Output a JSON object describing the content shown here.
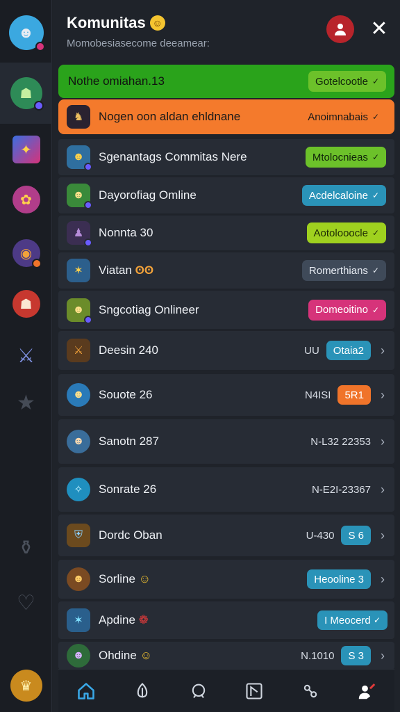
{
  "header": {
    "title": "Komunitas",
    "subtitle": "Momobesiasecome deeamear:"
  },
  "banners": [
    {
      "label": "Nothe omiahan.13",
      "action": "Gotelcootle"
    },
    {
      "label": "Nogen oon aldan ehldnane",
      "action": "Anoimnabais"
    }
  ],
  "rows": [
    {
      "name": "Sgenantags Commitas Nere",
      "status": "Mtolocnieas",
      "status_color": "#6cc12a"
    },
    {
      "name": "Dayorofiag Omline",
      "status": "Acdelcaloine",
      "status_color": "#2a93b8"
    },
    {
      "name": "Nonnta 30",
      "status": "Aotolooocle",
      "status_color": "#9fd11f"
    },
    {
      "name": "Viatan",
      "status": "Romerthians",
      "status_color": "#3f4a59"
    },
    {
      "name": "Sngcotiag Onlineer",
      "status": "Domeoitino",
      "status_color": "#d6337a"
    }
  ],
  "list": [
    {
      "name": "Deesin 240",
      "code": "UU",
      "badge": "Otaia2",
      "badge_color": "#2a93b8"
    },
    {
      "name": "Souote 26",
      "code": "N4ISI",
      "badge": "5R1",
      "badge_color": "#f0742a"
    },
    {
      "name": "Sanotn 287",
      "code": "N-L32 22353",
      "badge": "",
      "badge_color": ""
    },
    {
      "name": "Sonrate 26",
      "code": "N-E2I-23367",
      "badge": "",
      "badge_color": ""
    },
    {
      "name": "Dordc Oban",
      "code": "U-430",
      "badge": "S 6",
      "badge_color": "#2a93b8"
    },
    {
      "name": "Sorline",
      "code": "",
      "badge": "Heooline 3",
      "badge_color": "#2a93b8"
    },
    {
      "name": "Apdine",
      "code": "",
      "badge": "I Meocerd",
      "badge_color": "#2a93b8"
    },
    {
      "name": "Ohdine",
      "code": "N.1010",
      "badge": "S 3",
      "badge_color": "#2a93b8"
    }
  ],
  "colors": {
    "accent_green": "#2aa31b",
    "accent_orange": "#f47a2c",
    "background": "#1f232a"
  }
}
